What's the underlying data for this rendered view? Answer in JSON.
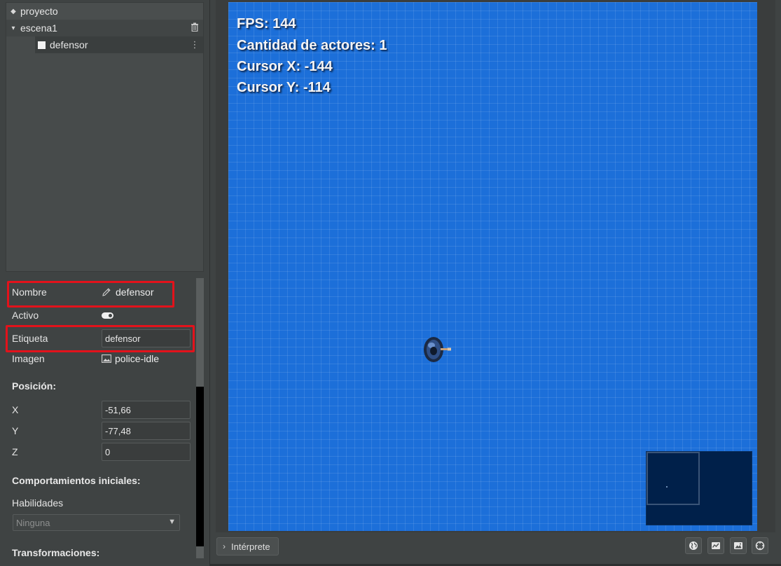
{
  "tree": {
    "project": "proyecto",
    "scene": "escena1",
    "actor": "defensor"
  },
  "properties": {
    "nombre_label": "Nombre",
    "nombre_value": "defensor",
    "activo_label": "Activo",
    "activo_value": true,
    "etiqueta_label": "Etiqueta",
    "etiqueta_value": "defensor",
    "imagen_label": "Imagen",
    "imagen_value": "police-idle",
    "posicion_title": "Posición:",
    "x_label": "X",
    "x_value": "-51,66",
    "y_label": "Y",
    "y_value": "-77,48",
    "z_label": "Z",
    "z_value": "0",
    "comportamientos_title": "Comportamientos iniciales:",
    "habilidades_label": "Habilidades",
    "habilidades_value": "Ninguna",
    "transformaciones_title": "Transformaciones:"
  },
  "hud": {
    "fps": "FPS: 144",
    "actors": "Cantidad de actores: 1",
    "cursor_x": "Cursor X: -144",
    "cursor_y": "Cursor Y: -114"
  },
  "bottombar": {
    "interprete_label": "Intérprete",
    "icons": [
      "globe-icon",
      "chart-icon",
      "image-icon",
      "crosshair-icon"
    ]
  },
  "colors": {
    "canvas_bg": "#1c6fd9",
    "highlight": "#e3121b",
    "panel_bg": "#3f4343"
  }
}
